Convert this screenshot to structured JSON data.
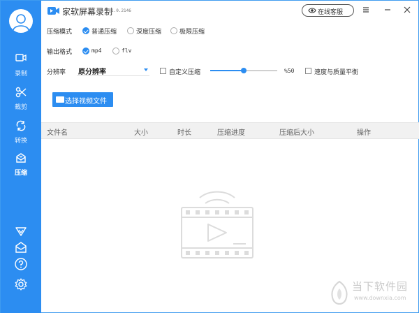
{
  "app": {
    "title": "家软屏幕录制",
    "version": "1.0.2146",
    "service_label": "在线客服"
  },
  "sidebar": {
    "items": [
      {
        "label": "录制",
        "icon": "video-icon"
      },
      {
        "label": "裁剪",
        "icon": "scissors-icon"
      },
      {
        "label": "转换",
        "icon": "convert-icon"
      },
      {
        "label": "压缩",
        "icon": "compress-icon"
      }
    ],
    "bottom_icons": [
      "vip-icon",
      "mail-icon",
      "help-icon",
      "settings-icon"
    ]
  },
  "options": {
    "compress_mode_label": "压缩模式",
    "compress_modes": [
      {
        "label": "普通压缩",
        "selected": true
      },
      {
        "label": "深度压缩",
        "selected": false
      },
      {
        "label": "极限压缩",
        "selected": false
      }
    ],
    "output_format_label": "输出格式",
    "output_formats": [
      {
        "label": "mp4",
        "selected": true
      },
      {
        "label": "flv",
        "selected": false
      }
    ],
    "resolution_label": "分辨率",
    "resolution_value": "原分辨率",
    "custom_compress_label": "自定义压缩",
    "quality_value": "%50",
    "quality_percent": 50,
    "balance_label": "速度与质量平衡"
  },
  "actions": {
    "select_file_label": "选择视频文件"
  },
  "table": {
    "headers": [
      "文件名",
      "大小",
      "时长",
      "压缩进度",
      "压缩后大小",
      "操作"
    ]
  },
  "watermark": {
    "text": "当下软件园",
    "url": "www.downxia.com"
  },
  "colors": {
    "accent": "#2c8df1"
  }
}
